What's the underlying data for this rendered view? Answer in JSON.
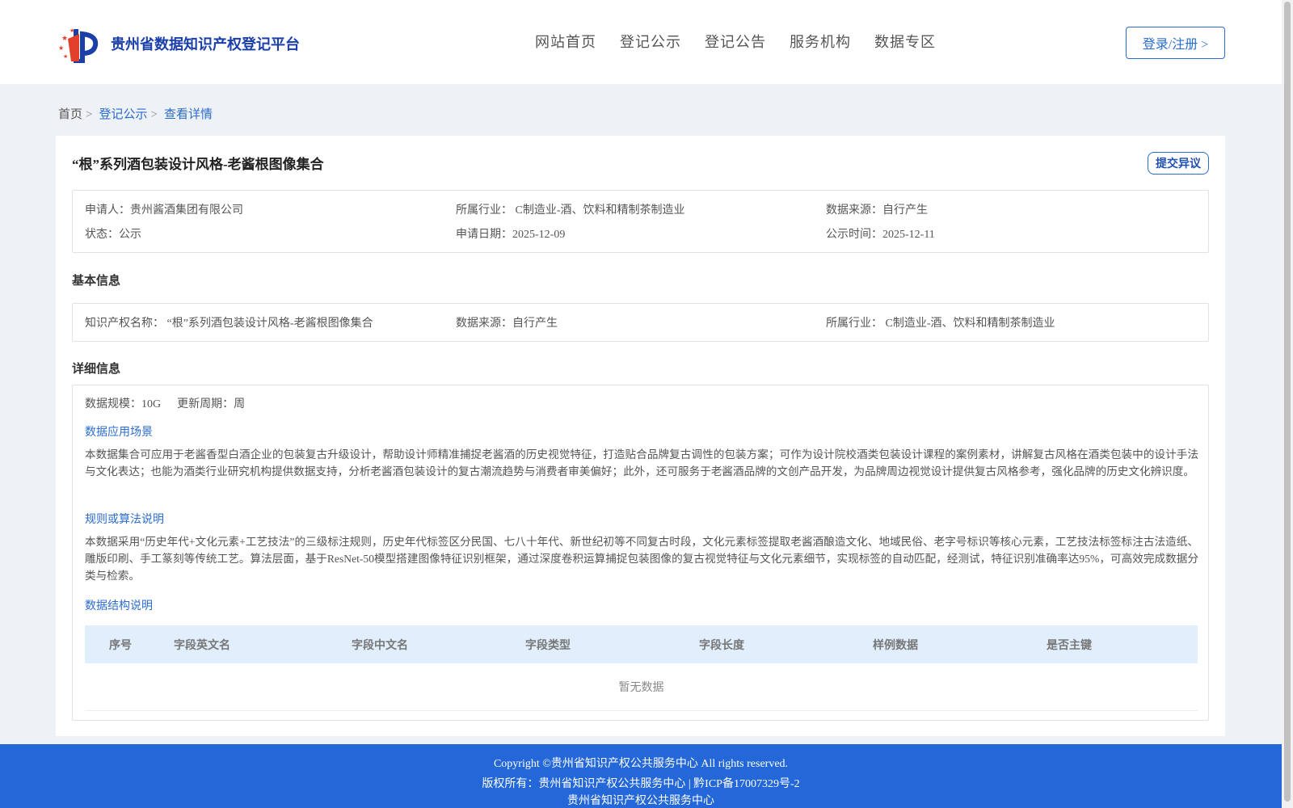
{
  "header": {
    "brand": "贵州省数据知识产权登记平台",
    "nav": [
      "网站首页",
      "登记公示",
      "登记公告",
      "服务机构",
      "数据专区"
    ],
    "login_label": "登录/注册 >"
  },
  "breadcrumb": {
    "home": "首页",
    "publicity": "登记公示",
    "current": "查看详情",
    "sep": ">"
  },
  "detail": {
    "title": "“根”系列酒包装设计风格-老酱根图像集合",
    "objection_label": "提交异议",
    "summary": {
      "applicant": "申请人：贵州酱酒集团有限公司",
      "industry": "所属行业： C制造业-酒、饮料和精制茶制造业",
      "source": "数据来源：自行产生",
      "status": "状态：公示",
      "apply_date": "申请日期：2025-12-09",
      "publicity_date": "公示时间：2025-12-11"
    },
    "basic": {
      "section_title": "基本信息",
      "ip_name": "知识产权名称： “根”系列酒包装设计风格-老酱根图像集合",
      "source": "数据来源：自行产生",
      "industry": "所属行业： C制造业-酒、饮料和精制茶制造业"
    },
    "detail_info": {
      "section_title": "详细信息",
      "scale": "数据规模：10G",
      "cycle": "更新周期：周",
      "scenario_title": "数据应用场景",
      "scenario_text": "本数据集合可应用于老酱香型白酒企业的包装复古升级设计，帮助设计师精准捕捉老酱酒的历史视觉特征，打造贴合品牌复古调性的包装方案；可作为设计院校酒类包装设计课程的案例素材，讲解复古风格在酒类包装中的设计手法与文化表达；也能为酒类行业研究机构提供数据支持，分析老酱酒包装设计的复古潮流趋势与消费者审美偏好；此外，还可服务于老酱酒品牌的文创产品开发，为品牌周边视觉设计提供复古风格参考，强化品牌的历史文化辨识度。",
      "rule_title": "规则或算法说明",
      "rule_text": "本数据采用“历史年代+文化元素+工艺技法”的三级标注规则，历史年代标签区分民国、七八十年代、新世纪初等不同复古时段，文化元素标签提取老酱酒酿造文化、地域民俗、老字号标识等核心元素，工艺技法标签标注古法造纸、雕版印刷、手工篆刻等传统工艺。算法层面，基于ResNet-50模型搭建图像特征识别框架，通过深度卷积运算捕捉包装图像的复古视觉特征与文化元素细节，实现标签的自动匹配，经测试，特征识别准确率达95%，可高效完成数据分类与检索。",
      "structure_title": "数据结构说明",
      "columns": [
        "序号",
        "字段英文名",
        "字段中文名",
        "字段类型",
        "字段长度",
        "样例数据",
        "是否主键"
      ],
      "empty_text": "暂无数据"
    }
  },
  "footer": {
    "copyright": "Copyright ©贵州省知识产权公共服务中心 All rights reserved.",
    "owner": "版权所有：贵州省知识产权公共服务中心 | 黔ICP备17007329号-2",
    "org": "贵州省知识产权公共服务中心"
  }
}
